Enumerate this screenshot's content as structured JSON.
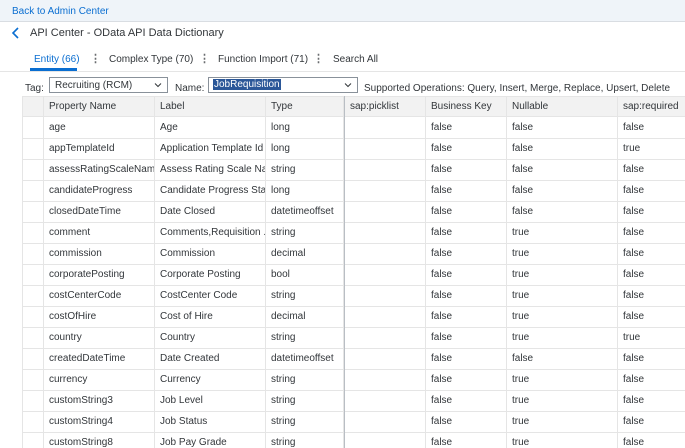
{
  "topbar": {
    "back_link": "Back to Admin Center"
  },
  "header": {
    "title": "API Center - OData API Data Dictionary"
  },
  "tabs": [
    {
      "label": "Entity (66)",
      "active": true
    },
    {
      "label": "Complex Type (70)",
      "active": false
    },
    {
      "label": "Function Import (71)",
      "active": false
    },
    {
      "label": "Search All",
      "active": false
    }
  ],
  "filters": {
    "tag_label": "Tag:",
    "tag_value": "Recruiting (RCM)",
    "name_label": "Name:",
    "name_value": "JobRequisition",
    "supported_operations": "Supported Operations: Query, Insert, Merge, Replace, Upsert, Delete"
  },
  "table": {
    "columns": [
      "Property Name",
      "Label",
      "Type",
      "sap:picklist",
      "Business Key",
      "Nullable",
      "sap:required"
    ],
    "sorted_column": "Property Name",
    "rows": [
      [
        "age",
        "Age",
        "long",
        "",
        "false",
        "false",
        "false"
      ],
      [
        "appTemplateId",
        "Application Template Id",
        "long",
        "",
        "false",
        "false",
        "true"
      ],
      [
        "assessRatingScaleName",
        "Assess Rating Scale Na...",
        "string",
        "",
        "false",
        "false",
        "false"
      ],
      [
        "candidateProgress",
        "Candidate Progress Sta...",
        "long",
        "",
        "false",
        "false",
        "false"
      ],
      [
        "closedDateTime",
        "Date Closed",
        "datetimeoffset",
        "",
        "false",
        "false",
        "false"
      ],
      [
        "comment",
        "Comments,Requisition ...",
        "string",
        "",
        "false",
        "true",
        "false"
      ],
      [
        "commission",
        "Commission",
        "decimal",
        "",
        "false",
        "true",
        "false"
      ],
      [
        "corporatePosting",
        "Corporate Posting",
        "bool",
        "",
        "false",
        "true",
        "false"
      ],
      [
        "costCenterCode",
        "CostCenter Code",
        "string",
        "",
        "false",
        "true",
        "false"
      ],
      [
        "costOfHire",
        "Cost of Hire",
        "decimal",
        "",
        "false",
        "true",
        "false"
      ],
      [
        "country",
        "Country",
        "string",
        "",
        "false",
        "true",
        "true"
      ],
      [
        "createdDateTime",
        "Date Created",
        "datetimeoffset",
        "",
        "false",
        "false",
        "false"
      ],
      [
        "currency",
        "Currency",
        "string",
        "",
        "false",
        "true",
        "false"
      ],
      [
        "customString3",
        "Job Level",
        "string",
        "",
        "false",
        "true",
        "false"
      ],
      [
        "customString4",
        "Job Status",
        "string",
        "",
        "false",
        "true",
        "false"
      ],
      [
        "customString8",
        "Job Pay Grade",
        "string",
        "",
        "false",
        "true",
        "false"
      ]
    ]
  },
  "icons": {
    "back": "chevron-left-icon",
    "tab_overflow": "vertical-ellipsis-icon",
    "dropdown": "chevron-down-icon",
    "sort": "sort-ascending-icon"
  },
  "colors": {
    "accent": "#0a6ed1",
    "topbar_bg": "#eff4f9",
    "selection_bg": "#2b5798",
    "header_row_bg": "#f2f2f2"
  }
}
